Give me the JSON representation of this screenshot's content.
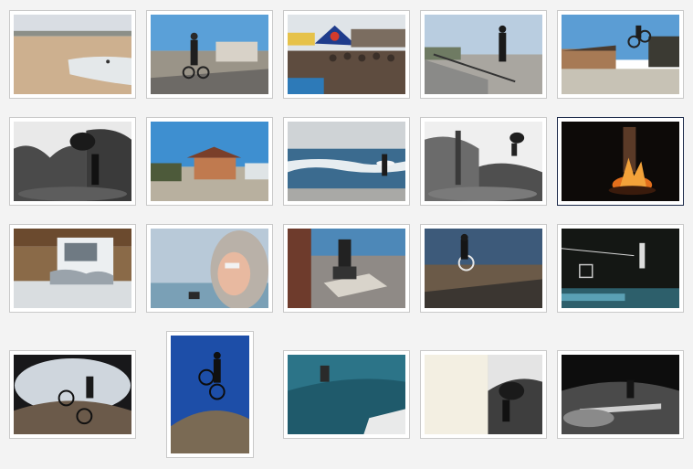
{
  "gallery": {
    "selected_index": 9,
    "photos": [
      {
        "subject": "beach-scene"
      },
      {
        "subject": "bmx-rider-street"
      },
      {
        "subject": "crowd-under-tent"
      },
      {
        "subject": "skater-rail-grind"
      },
      {
        "subject": "bmx-jump-building"
      },
      {
        "subject": "rider-airborne-trees"
      },
      {
        "subject": "pagoda-building"
      },
      {
        "subject": "surfer-waves"
      },
      {
        "subject": "skater-trees"
      },
      {
        "subject": "campfire-night"
      },
      {
        "subject": "graffiti-pavilion"
      },
      {
        "subject": "person-hood-phone"
      },
      {
        "subject": "skater-box"
      },
      {
        "subject": "bmx-ramp-sunset"
      },
      {
        "subject": "night-skatepark"
      },
      {
        "subject": "bmx-fisheye-wheelie"
      },
      {
        "subject": "bmx-jump-blue-sky"
      },
      {
        "subject": "pool-skater"
      },
      {
        "subject": "skater-split-frame"
      },
      {
        "subject": "skater-night-bench"
      }
    ]
  }
}
